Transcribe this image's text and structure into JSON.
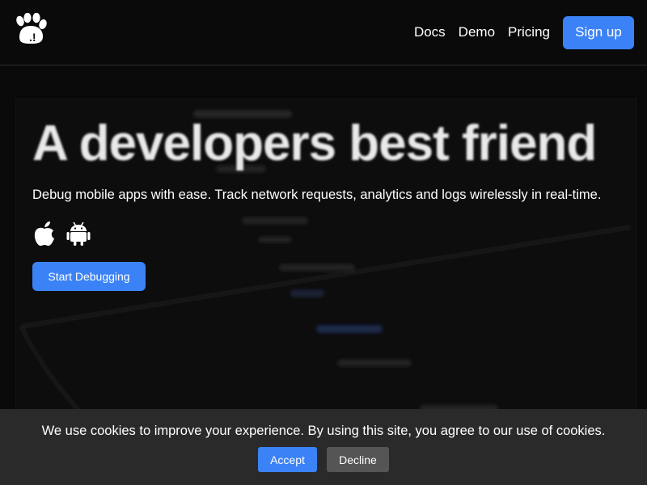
{
  "nav": {
    "logo_icon": "paw-print-logo-icon",
    "links": [
      "Docs",
      "Demo",
      "Pricing"
    ],
    "signup_label": "Sign up"
  },
  "hero": {
    "title": "A developers best friend",
    "subtitle": "Debug mobile apps with ease. Track network requests, analytics and logs wirelessly in real-time.",
    "platform_icons": [
      "apple-icon",
      "android-icon"
    ],
    "cta_label": "Start Debugging"
  },
  "cookie_banner": {
    "message": "We use cookies to improve your experience. By using this site, you agree to our use of cookies.",
    "accept_label": "Accept",
    "decline_label": "Decline"
  },
  "colors": {
    "background": "#0a0a0a",
    "accent": "#3b82f6",
    "banner": "#2a2a2a",
    "decline": "#555555"
  }
}
